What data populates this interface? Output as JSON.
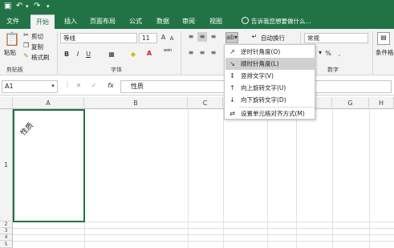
{
  "titlebar": {
    "save_icon": "save-icon",
    "undo_icon": "undo-icon",
    "redo_icon": "redo-icon"
  },
  "tabs": [
    "文件",
    "开始",
    "插入",
    "页面布局",
    "公式",
    "数据",
    "审阅",
    "视图"
  ],
  "active_tab": "开始",
  "tell_me": "告诉我您想要做什么...",
  "clipboard": {
    "paste": "粘贴",
    "cut": "剪切",
    "copy": "复制",
    "format_painter": "格式刷",
    "group_label": "剪贴板"
  },
  "font": {
    "name": "等线",
    "size": "11",
    "bold": "B",
    "italic": "I",
    "underline": "U",
    "grow": "A",
    "shrink": "A",
    "wen": "wén",
    "group_label": "字体"
  },
  "alignment": {
    "wrap_text": "自动换行"
  },
  "number": {
    "format": "常规",
    "percent": "%",
    "group_label": "数字"
  },
  "styles": {
    "conditional": "条件格"
  },
  "formula_bar": {
    "name_box": "A1",
    "fx": "fx",
    "value": "性质"
  },
  "columns": [
    "A",
    "B",
    "C",
    "D",
    "E",
    "F",
    "G",
    "H"
  ],
  "rows": [
    "1",
    "2",
    "3",
    "4",
    "5"
  ],
  "cell_a1": "性质",
  "orientation_menu": {
    "items": [
      {
        "label": "逆时针角度(O)",
        "icon": "ab-counterclockwise-icon"
      },
      {
        "label": "顺时针角度(L)",
        "icon": "ab-clockwise-icon",
        "highlighted": true
      },
      {
        "label": "竖排文字(V)",
        "icon": "vertical-text-icon"
      },
      {
        "label": "向上旋转文字(U)",
        "icon": "rotate-up-icon"
      },
      {
        "label": "向下旋转文字(D)",
        "icon": "rotate-down-icon"
      },
      {
        "label": "设置单元格对齐方式(M)",
        "icon": "format-alignment-icon"
      }
    ]
  },
  "colors": {
    "excel_green": "#217346",
    "highlight": "#d0d0d0",
    "font_red": "#e81123"
  }
}
